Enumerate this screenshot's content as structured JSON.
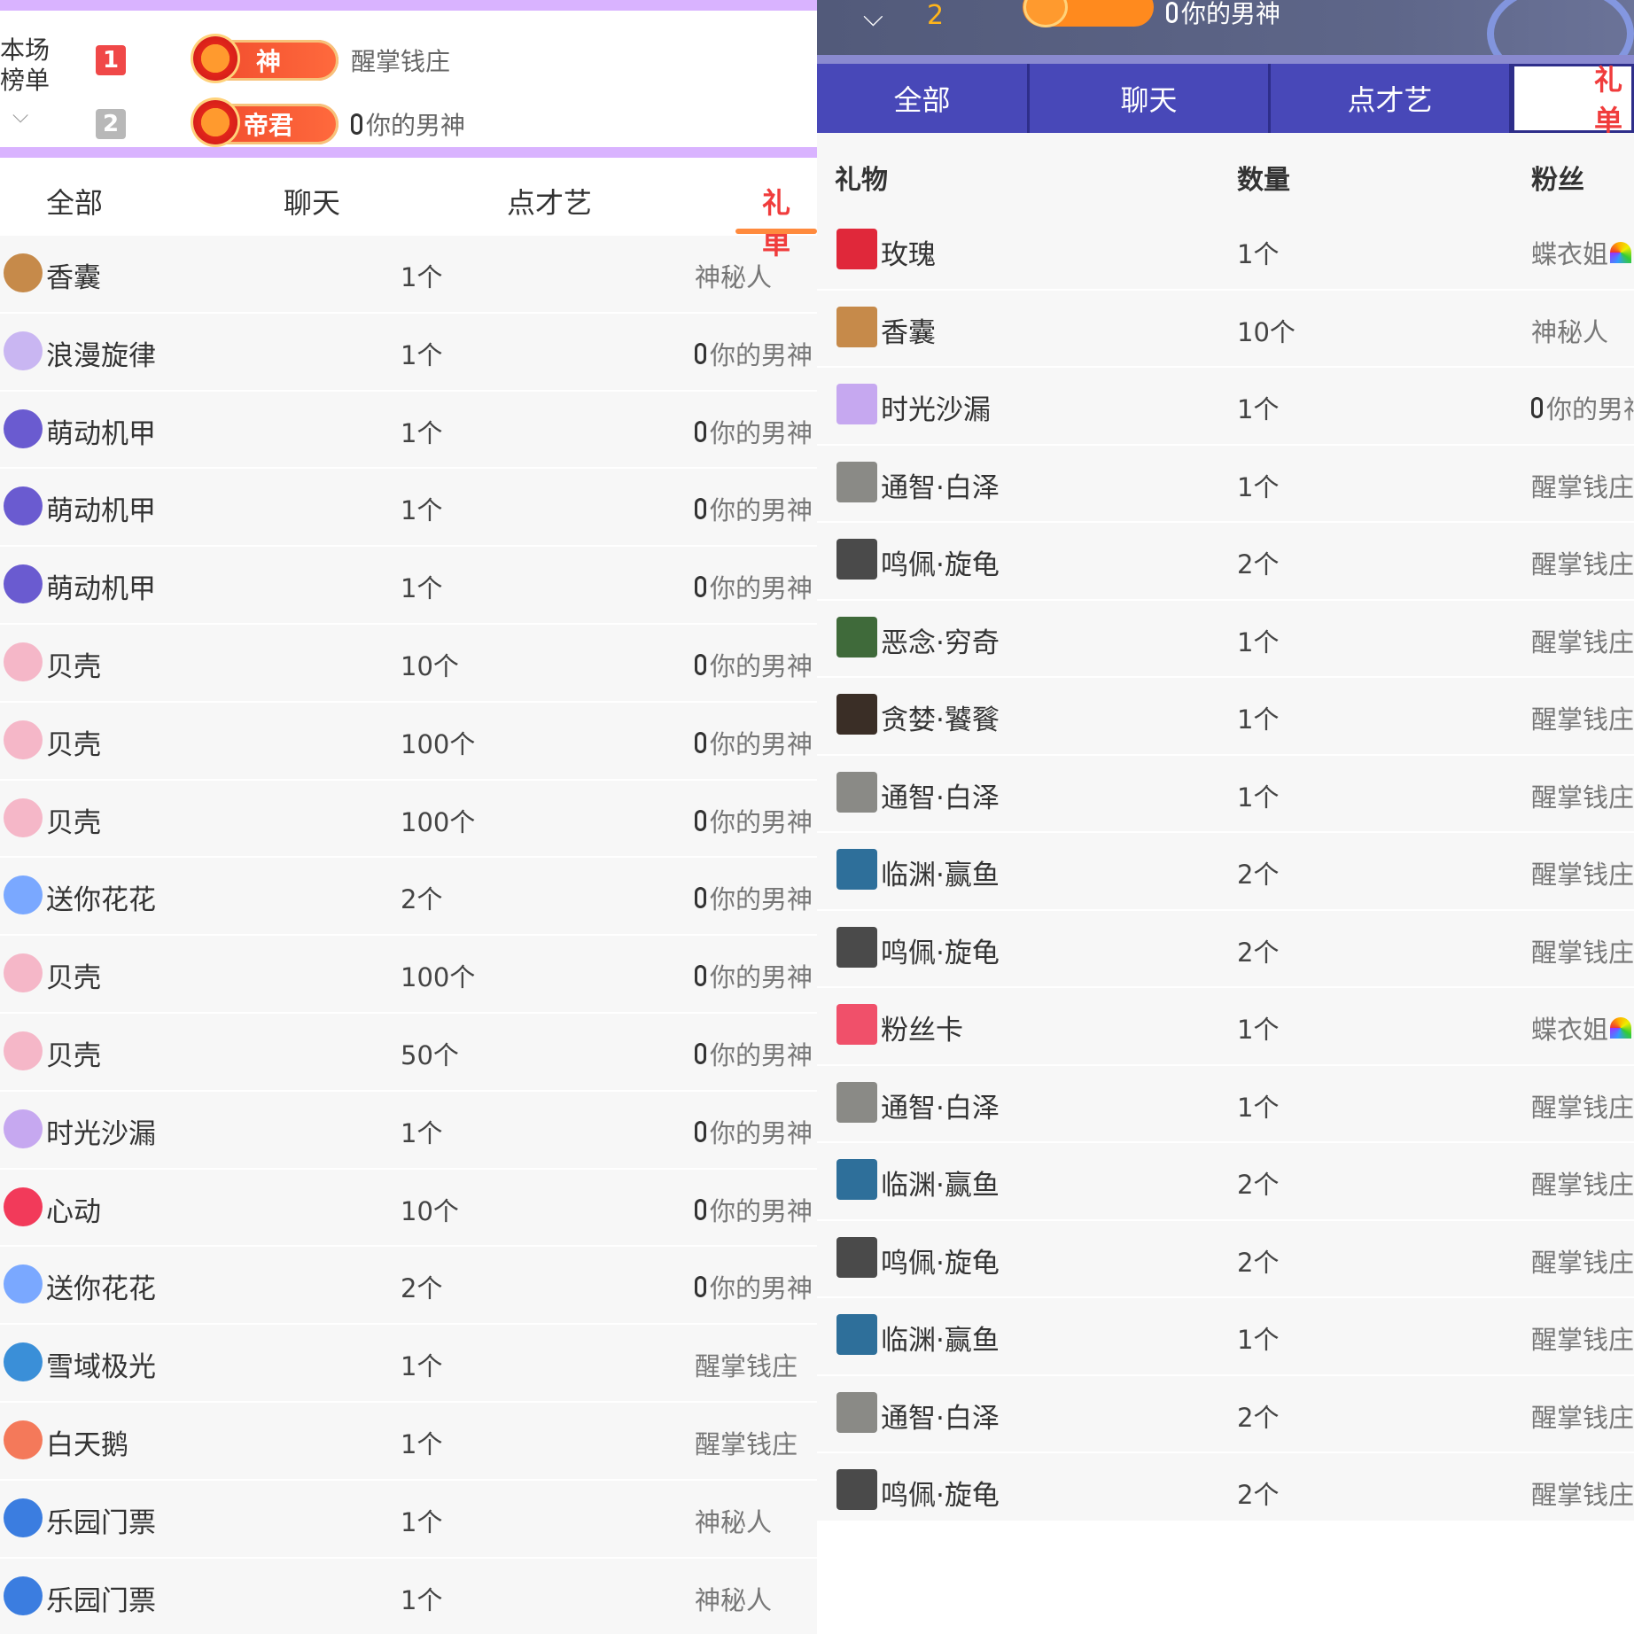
{
  "left": {
    "rank": {
      "title": "本场\n榜单",
      "rows": [
        {
          "num": "1",
          "num_color": "#f04848",
          "badge": "神",
          "name": "醒掌钱庄",
          "mic": false
        },
        {
          "num": "2",
          "num_color": "#b8b8b8",
          "badge": "帝君",
          "name": "你的男神",
          "mic": true
        }
      ]
    },
    "tabs": [
      "全部",
      "聊天",
      "点才艺",
      "礼单"
    ],
    "rows": [
      {
        "name": "香囊",
        "qty": "1个",
        "fan": "神秘人",
        "mic": false,
        "icon_color": "#c68a4a"
      },
      {
        "name": "浪漫旋律",
        "qty": "1个",
        "fan": "你的男神",
        "mic": true,
        "icon_color": "#c9b6f2"
      },
      {
        "name": "萌动机甲",
        "qty": "1个",
        "fan": "你的男神",
        "mic": true,
        "icon_color": "#6a5bd0"
      },
      {
        "name": "萌动机甲",
        "qty": "1个",
        "fan": "你的男神",
        "mic": true,
        "icon_color": "#6a5bd0"
      },
      {
        "name": "萌动机甲",
        "qty": "1个",
        "fan": "你的男神",
        "mic": true,
        "icon_color": "#6a5bd0"
      },
      {
        "name": "贝壳",
        "qty": "10个",
        "fan": "你的男神",
        "mic": true,
        "icon_color": "#f5b7c8"
      },
      {
        "name": "贝壳",
        "qty": "100个",
        "fan": "你的男神",
        "mic": true,
        "icon_color": "#f5b7c8"
      },
      {
        "name": "贝壳",
        "qty": "100个",
        "fan": "你的男神",
        "mic": true,
        "icon_color": "#f5b7c8"
      },
      {
        "name": "送你花花",
        "qty": "2个",
        "fan": "你的男神",
        "mic": true,
        "icon_color": "#7aa8ff"
      },
      {
        "name": "贝壳",
        "qty": "100个",
        "fan": "你的男神",
        "mic": true,
        "icon_color": "#f5b7c8"
      },
      {
        "name": "贝壳",
        "qty": "50个",
        "fan": "你的男神",
        "mic": true,
        "icon_color": "#f5b7c8"
      },
      {
        "name": "时光沙漏",
        "qty": "1个",
        "fan": "你的男神",
        "mic": true,
        "icon_color": "#c6a8f0"
      },
      {
        "name": "心动",
        "qty": "10个",
        "fan": "你的男神",
        "mic": true,
        "icon_color": "#f23a5a"
      },
      {
        "name": "送你花花",
        "qty": "2个",
        "fan": "你的男神",
        "mic": true,
        "icon_color": "#7aa8ff"
      },
      {
        "name": "雪域极光",
        "qty": "1个",
        "fan": "醒掌钱庄",
        "mic": false,
        "icon_color": "#3a8fd8"
      },
      {
        "name": "白天鹅",
        "qty": "1个",
        "fan": "醒掌钱庄",
        "mic": false,
        "icon_color": "#f4795a"
      },
      {
        "name": "乐园门票",
        "qty": "1个",
        "fan": "神秘人",
        "mic": false,
        "icon_color": "#3b7de0"
      },
      {
        "name": "乐园门票",
        "qty": "1个",
        "fan": "神秘人",
        "mic": false,
        "icon_color": "#3b7de0"
      }
    ]
  },
  "right": {
    "top": {
      "num": "2",
      "name": "你的男神"
    },
    "tabs": [
      "全部",
      "聊天",
      "点才艺",
      "礼单"
    ],
    "headers": {
      "gift": "礼物",
      "qty": "数量",
      "fan": "粉丝"
    },
    "rows": [
      {
        "name": "玫瑰",
        "qty": "1个",
        "fan": "蝶衣姐",
        "mic": false,
        "rainbow": true,
        "icon_color": "#e0283a"
      },
      {
        "name": "香囊",
        "qty": "10个",
        "fan": "神秘人",
        "mic": false,
        "rainbow": false,
        "icon_color": "#c68a4a"
      },
      {
        "name": "时光沙漏",
        "qty": "1个",
        "fan": "你的男神",
        "mic": true,
        "rainbow": false,
        "icon_color": "#c6a8f0"
      },
      {
        "name": "通智·白泽",
        "qty": "1个",
        "fan": "醒掌钱庄",
        "mic": false,
        "rainbow": false,
        "icon_color": "#8a8a86"
      },
      {
        "name": "鸣佩·旋龟",
        "qty": "2个",
        "fan": "醒掌钱庄",
        "mic": false,
        "rainbow": false,
        "icon_color": "#4a4a4a"
      },
      {
        "name": "恶念·穷奇",
        "qty": "1个",
        "fan": "醒掌钱庄",
        "mic": false,
        "rainbow": false,
        "icon_color": "#3f6a3a"
      },
      {
        "name": "贪婪·饕餮",
        "qty": "1个",
        "fan": "醒掌钱庄",
        "mic": false,
        "rainbow": false,
        "icon_color": "#3a2e26"
      },
      {
        "name": "通智·白泽",
        "qty": "1个",
        "fan": "醒掌钱庄",
        "mic": false,
        "rainbow": false,
        "icon_color": "#8a8a86"
      },
      {
        "name": "临渊·赢鱼",
        "qty": "2个",
        "fan": "醒掌钱庄",
        "mic": false,
        "rainbow": false,
        "icon_color": "#2e6f9a"
      },
      {
        "name": "鸣佩·旋龟",
        "qty": "2个",
        "fan": "醒掌钱庄",
        "mic": false,
        "rainbow": false,
        "icon_color": "#4a4a4a"
      },
      {
        "name": "粉丝卡",
        "qty": "1个",
        "fan": "蝶衣姐",
        "mic": false,
        "rainbow": true,
        "icon_color": "#f0506a"
      },
      {
        "name": "通智·白泽",
        "qty": "1个",
        "fan": "醒掌钱庄",
        "mic": false,
        "rainbow": false,
        "icon_color": "#8a8a86"
      },
      {
        "name": "临渊·赢鱼",
        "qty": "2个",
        "fan": "醒掌钱庄",
        "mic": false,
        "rainbow": false,
        "icon_color": "#2e6f9a"
      },
      {
        "name": "鸣佩·旋龟",
        "qty": "2个",
        "fan": "醒掌钱庄",
        "mic": false,
        "rainbow": false,
        "icon_color": "#4a4a4a"
      },
      {
        "name": "临渊·赢鱼",
        "qty": "1个",
        "fan": "醒掌钱庄",
        "mic": false,
        "rainbow": false,
        "icon_color": "#2e6f9a"
      },
      {
        "name": "通智·白泽",
        "qty": "2个",
        "fan": "醒掌钱庄",
        "mic": false,
        "rainbow": false,
        "icon_color": "#8a8a86"
      },
      {
        "name": "鸣佩·旋龟",
        "qty": "2个",
        "fan": "醒掌钱庄",
        "mic": false,
        "rainbow": false,
        "icon_color": "#4a4a4a"
      }
    ]
  }
}
